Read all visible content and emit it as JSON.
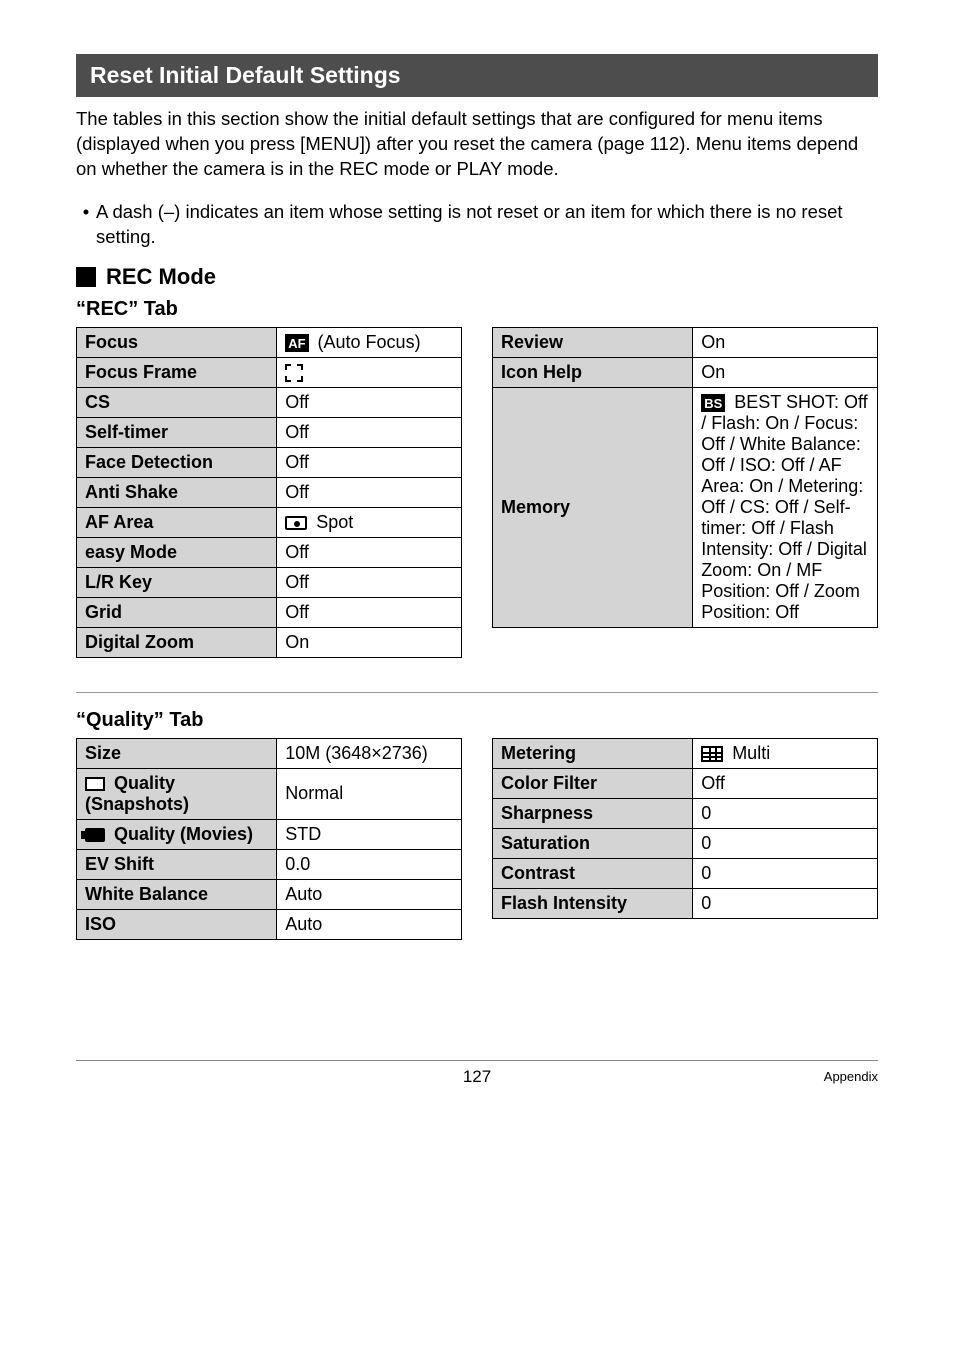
{
  "banner": "Reset Initial Default Settings",
  "intro": "The tables in this section show the initial default settings that are configured for menu items (displayed when you press [MENU]) after you reset the camera (page 112). Menu items depend on whether the camera is in the REC mode or PLAY mode.",
  "bullet": "A dash (–) indicates an item whose setting is not reset or an item for which there is no reset setting.",
  "recModeHeading": "REC Mode",
  "recTabTitle": "“REC” Tab",
  "qualityTabTitle": "“Quality” Tab",
  "recLeft": [
    {
      "k": "Focus",
      "icon": "af-chip",
      "v": " (Auto Focus)"
    },
    {
      "k": "Focus Frame",
      "icon": "corners",
      "v": ""
    },
    {
      "k": "CS",
      "v": "Off"
    },
    {
      "k": "Self-timer",
      "v": "Off"
    },
    {
      "k": "Face Detection",
      "v": "Off"
    },
    {
      "k": "Anti Shake",
      "v": "Off"
    },
    {
      "k": "AF Area",
      "icon": "spot",
      "v": " Spot"
    },
    {
      "k": "easy Mode",
      "v": "Off"
    },
    {
      "k": "L/R Key",
      "v": "Off"
    },
    {
      "k": "Grid",
      "v": "Off"
    },
    {
      "k": "Digital Zoom",
      "v": "On"
    }
  ],
  "recRight": [
    {
      "k": "Review",
      "v": "On"
    },
    {
      "k": "Icon Help",
      "v": "On"
    },
    {
      "k": "Memory",
      "icon": "bs-chip",
      "v": " BEST SHOT: Off / Flash: On / Focus: Off / White Balance: Off / ISO: Off / AF Area: On / Metering: Off / CS: Off / Self-timer: Off / Flash Intensity: Off / Digital Zoom: On / MF Position: Off / Zoom Position: Off"
    }
  ],
  "qualityLeft": [
    {
      "k": "Size",
      "v": "10M (3648×2736)"
    },
    {
      "kicon": "snap",
      "k": " Quality (Snapshots)",
      "v": "Normal"
    },
    {
      "kicon": "movie",
      "k": " Quality (Movies)",
      "v": "STD"
    },
    {
      "k": "EV Shift",
      "v": "0.0"
    },
    {
      "k": "White Balance",
      "v": "Auto"
    },
    {
      "k": "ISO",
      "v": "Auto"
    }
  ],
  "qualityRight": [
    {
      "k": "Metering",
      "icon": "multi",
      "v": " Multi"
    },
    {
      "k": "Color Filter",
      "v": "Off"
    },
    {
      "k": "Sharpness",
      "v": "0"
    },
    {
      "k": "Saturation",
      "v": "0"
    },
    {
      "k": "Contrast",
      "v": "0"
    },
    {
      "k": "Flash Intensity",
      "v": "0"
    }
  ],
  "footer": {
    "page": "127",
    "section": "Appendix"
  }
}
